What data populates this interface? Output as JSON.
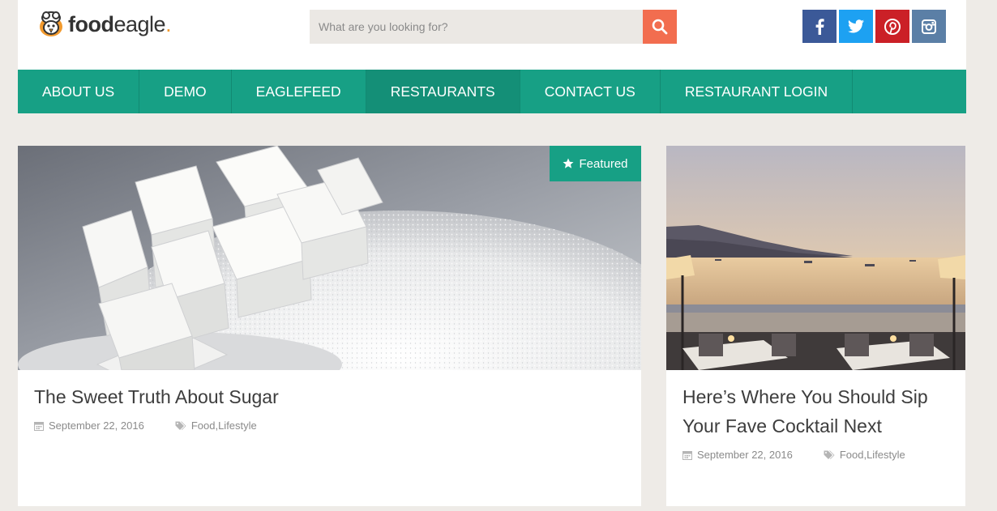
{
  "brand": {
    "name_bold": "food",
    "name_light": "eagle",
    "name_dot": "."
  },
  "search": {
    "placeholder": "What are you looking for?",
    "icon": "search-icon"
  },
  "social": [
    {
      "icon": "facebook-icon",
      "color": "#3b5998"
    },
    {
      "icon": "twitter-icon",
      "color": "#1da1f2"
    },
    {
      "icon": "pinterest-icon",
      "color": "#cb2027"
    },
    {
      "icon": "instagram-icon",
      "color": "#5b7fa6"
    }
  ],
  "nav": {
    "items": [
      {
        "label": "ABOUT US"
      },
      {
        "label": "DEMO"
      },
      {
        "label": "EAGLEFEED"
      },
      {
        "label": "RESTAURANTS",
        "active": true
      },
      {
        "label": "CONTACT US"
      },
      {
        "label": "RESTAURANT LOGIN"
      }
    ]
  },
  "posts": [
    {
      "badge": "Featured",
      "title": "The Sweet Truth About Sugar",
      "date": "September 22, 2016",
      "categories": [
        "Food",
        "Lifestyle"
      ],
      "category_separator": ", ",
      "image": "sugar-cubes-photo"
    },
    {
      "title_line1": "Here’s Where You Should Sip",
      "title_line2": "Your Fave Cocktail Next",
      "date": "September 22, 2016",
      "categories": [
        "Food",
        "Lifestyle"
      ],
      "category_separator": ", ",
      "image": "seaside-terrace-photo"
    }
  ],
  "colors": {
    "accent": "#17a085",
    "search_button": "#f26d4f",
    "logo_dot": "#f29a2e"
  }
}
